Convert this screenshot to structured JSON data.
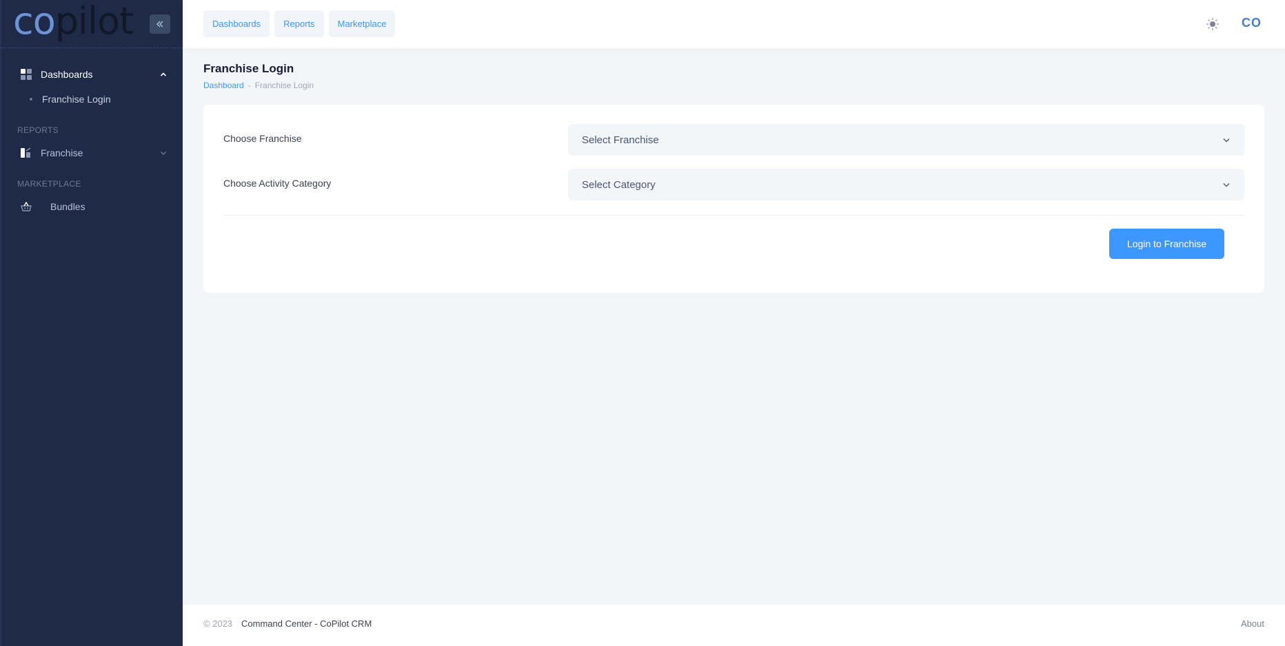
{
  "brand": {
    "logo_part1": "co",
    "logo_part2": "pilot"
  },
  "sidebar": {
    "dashboards_label": "Dashboards",
    "dashboards_sub": "Franchise Login",
    "reports_section": "REPORTS",
    "franchise_label": "Franchise",
    "marketplace_section": "MARKETPLACE",
    "bundles_label": "Bundles"
  },
  "header": {
    "tabs": [
      "Dashboards",
      "Reports",
      "Marketplace"
    ],
    "user_initials": "CO"
  },
  "toolbar": {
    "title": "Franchise Login",
    "breadcrumb_link": "Dashboard",
    "breadcrumb_sep": "-",
    "breadcrumb_current": "Franchise Login"
  },
  "form": {
    "franchise_label": "Choose Franchise",
    "franchise_value": "Select Franchise",
    "category_label": "Choose Activity Category",
    "category_value": "Select Category",
    "submit_label": "Login to Franchise"
  },
  "footer": {
    "copyright": "© 2023",
    "app_name": "Command Center - CoPilot CRM",
    "about": "About"
  },
  "colors": {
    "sidebar_bg": "#1e2a47",
    "accent": "#3e97ff",
    "logo_accent": "#6b93d6"
  }
}
